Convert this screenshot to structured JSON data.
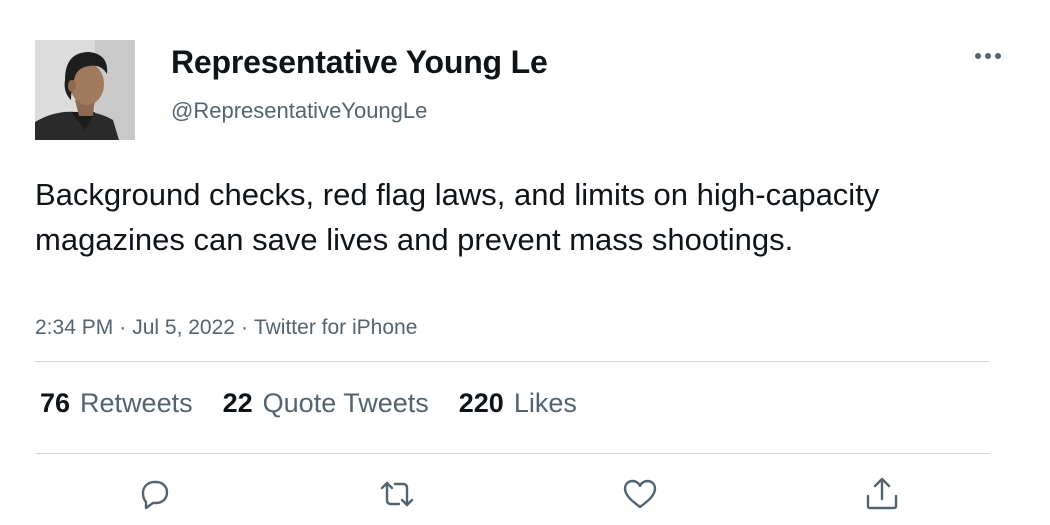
{
  "author": {
    "display_name": "Representative Young Le",
    "handle": "@RepresentativeYoungLe"
  },
  "tweet": {
    "text": "Background checks, red flag laws, and limits on high-capacity magazines can save lives and prevent mass shootings.",
    "time": "2:34 PM",
    "separator": "·",
    "date": "Jul 5, 2022",
    "source": "Twitter for iPhone"
  },
  "stats": {
    "retweets_count": "76",
    "retweets_label": "Retweets",
    "quotes_count": "22",
    "quotes_label": "Quote Tweets",
    "likes_count": "220",
    "likes_label": "Likes"
  },
  "icons": {
    "more": "more-horizontal-icon",
    "reply": "reply-icon",
    "retweet": "retweet-icon",
    "like": "heart-icon",
    "share": "share-icon"
  },
  "colors": {
    "text_primary": "#0f1419",
    "text_secondary": "#536471",
    "divider": "#cfd9de"
  }
}
